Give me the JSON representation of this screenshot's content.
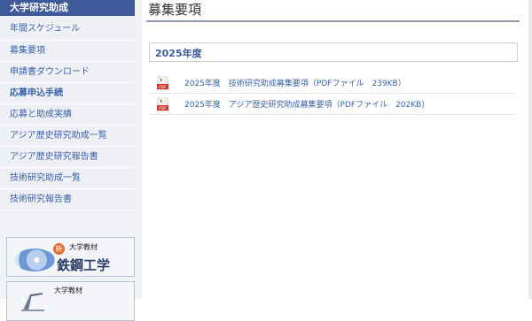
{
  "sidebar": {
    "title": "大学研究助成",
    "items": [
      {
        "label": "年間スケジュール"
      },
      {
        "label": "募集要項"
      },
      {
        "label": "申請書ダウンロード"
      },
      {
        "label": "応募申込手続"
      },
      {
        "label": "応募と助成実績"
      },
      {
        "label": "アジア歴史研究助成一覧"
      },
      {
        "label": "アジア歴史研究報告書"
      },
      {
        "label": "技術研究助成一覧"
      },
      {
        "label": "技術研究報告書"
      }
    ]
  },
  "banners": [
    {
      "badge": "新",
      "subtitle": "大学教材",
      "title": "鉄鋼工学"
    },
    {
      "subtitle": "大学教材"
    }
  ],
  "main": {
    "title": "募集要項",
    "section_year": "2025年度",
    "documents": [
      {
        "label": "2025年度　技術研究助成募集要項（PDFファイル　239KB）"
      },
      {
        "label": "2025年度　アジア歴史研究助成募集要項（PDFファイル　202KB）"
      }
    ]
  },
  "colors": {
    "accent": "#3f5a99",
    "link": "#3a63a8",
    "pdf_red": "#d8322b"
  }
}
